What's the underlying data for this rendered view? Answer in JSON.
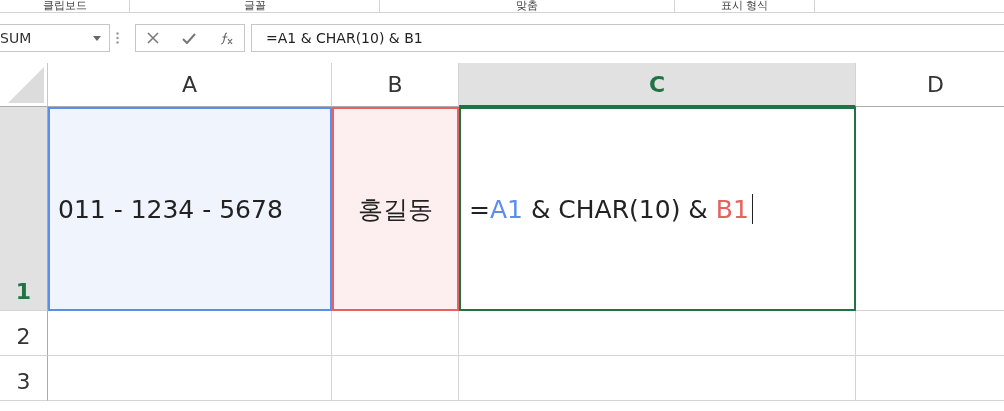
{
  "ribbon_groups": [
    {
      "label": "클립보드"
    },
    {
      "label": "글꼴"
    },
    {
      "label": "맞춤"
    },
    {
      "label": "표시 형식"
    }
  ],
  "formula_bar": {
    "name_box": "SUM",
    "formula": "=A1 & CHAR(10) & B1"
  },
  "columns": [
    {
      "label": "A",
      "selected": false
    },
    {
      "label": "B",
      "selected": false
    },
    {
      "label": "C",
      "selected": true
    },
    {
      "label": "D",
      "selected": false
    }
  ],
  "rows": [
    {
      "label": "1",
      "selected": true,
      "cells": [
        {
          "kind": "text",
          "text": "011 - 1234 - 5678",
          "color": "#5b8def"
        },
        {
          "kind": "text",
          "text": "홍길동",
          "color": "#e8605f"
        },
        {
          "kind": "formula",
          "tokens": [
            {
              "text": "=",
              "kind": "plain"
            },
            {
              "text": "A1",
              "kind": "ref",
              "color": "#5b8def"
            },
            {
              "text": " & CHAR(10) & ",
              "kind": "plain"
            },
            {
              "text": "B1",
              "kind": "ref",
              "color": "#e8605f"
            }
          ]
        },
        {
          "kind": "empty"
        }
      ]
    },
    {
      "label": "2",
      "selected": false,
      "cells": []
    },
    {
      "label": "3",
      "selected": false,
      "cells": []
    }
  ]
}
